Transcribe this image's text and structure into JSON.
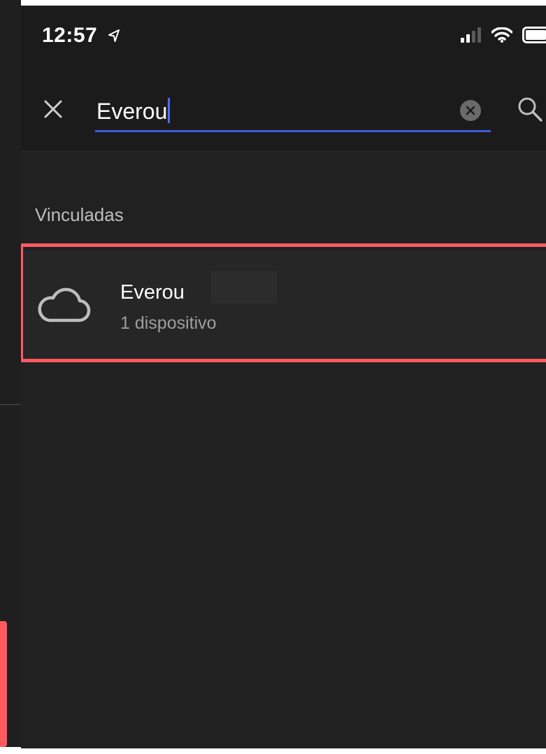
{
  "status_bar": {
    "time": "12:57",
    "location_icon": "location-arrow-icon",
    "signal_icon": "cellular-signal-icon",
    "wifi_icon": "wifi-icon",
    "battery_icon": "battery-icon"
  },
  "search": {
    "close_icon": "close-icon",
    "query": "Everou",
    "clear_icon": "clear-circle-icon",
    "search_icon": "search-icon"
  },
  "section": {
    "title": "Vinculadas"
  },
  "results": [
    {
      "icon": "cloud-icon",
      "title": "Everou",
      "subtitle": "1 dispositivo"
    }
  ],
  "colors": {
    "background": "#212121",
    "header": "#1b1b1b",
    "accent": "#3f5bd6",
    "highlight": "#ff5a5f"
  }
}
